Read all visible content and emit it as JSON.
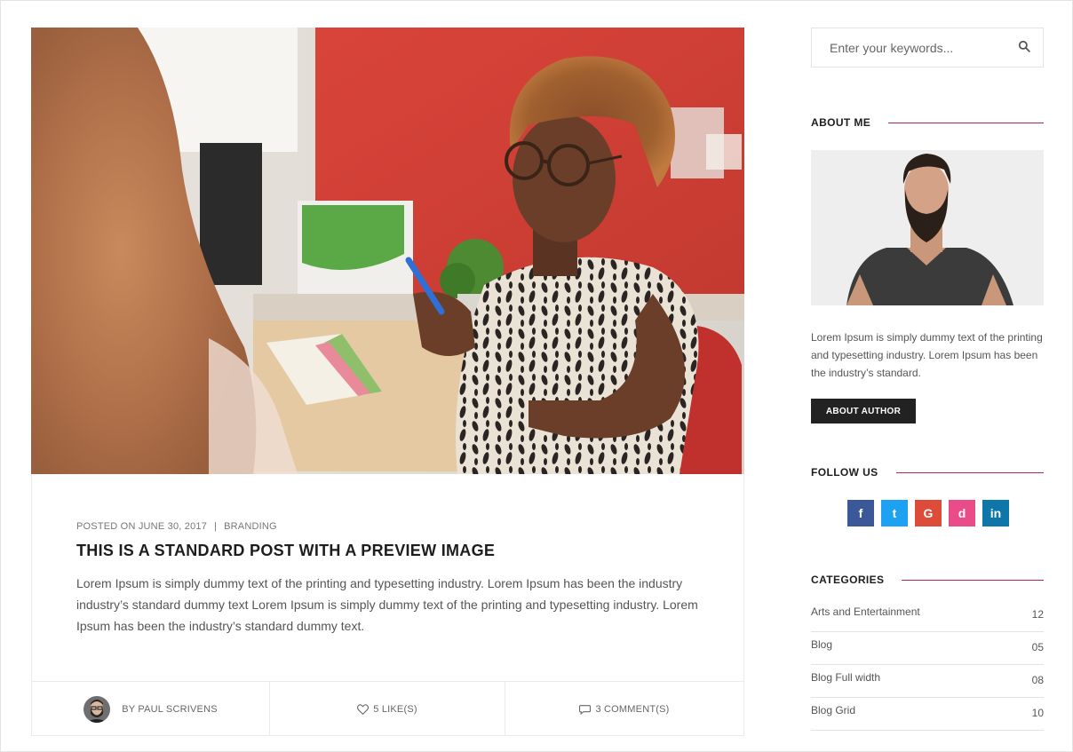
{
  "post": {
    "meta_date": "POSTED ON JUNE 30, 2017",
    "meta_separator": "|",
    "meta_category": "BRANDING",
    "title": "THIS IS A STANDARD POST WITH A PREVIEW IMAGE",
    "excerpt": "Lorem Ipsum is simply dummy text of the printing and typesetting industry. Lorem Ipsum has been the industry industry’s standard dummy text Lorem Ipsum is simply dummy text of the printing and typesetting industry. Lorem Ipsum has been the industry’s standard dummy text.",
    "author": "BY PAUL SCRIVENS",
    "likes": "5 LIKE(S)",
    "comments": "3 COMMENT(S)"
  },
  "sidebar": {
    "search_placeholder": "Enter your keywords...",
    "about": {
      "title": "ABOUT ME",
      "text": "Lorem Ipsum is simply dummy text of the printing and typesetting industry. Lorem Ipsum has been the industry’s standard.",
      "button": "ABOUT AUTHOR"
    },
    "follow": {
      "title": "FOLLOW US",
      "icons": [
        {
          "name": "facebook-icon",
          "glyph": "f",
          "color": "#3b5998"
        },
        {
          "name": "twitter-icon",
          "glyph": "t",
          "color": "#1da1f2"
        },
        {
          "name": "google-plus-icon",
          "glyph": "G",
          "color": "#dd4b39"
        },
        {
          "name": "dribbble-icon",
          "glyph": "d",
          "color": "#ea4c89"
        },
        {
          "name": "linkedin-icon",
          "glyph": "in",
          "color": "#0e76a8"
        }
      ]
    },
    "categories": {
      "title": "CATEGORIES",
      "items": [
        {
          "label": "Arts and Entertainment",
          "count": "12"
        },
        {
          "label": "Blog",
          "count": "05"
        },
        {
          "label": "Blog Full width",
          "count": "08"
        },
        {
          "label": "Blog Grid",
          "count": "10"
        }
      ]
    }
  },
  "colors": {
    "accent_line": "#b5245f",
    "button_dark": "#222222"
  }
}
